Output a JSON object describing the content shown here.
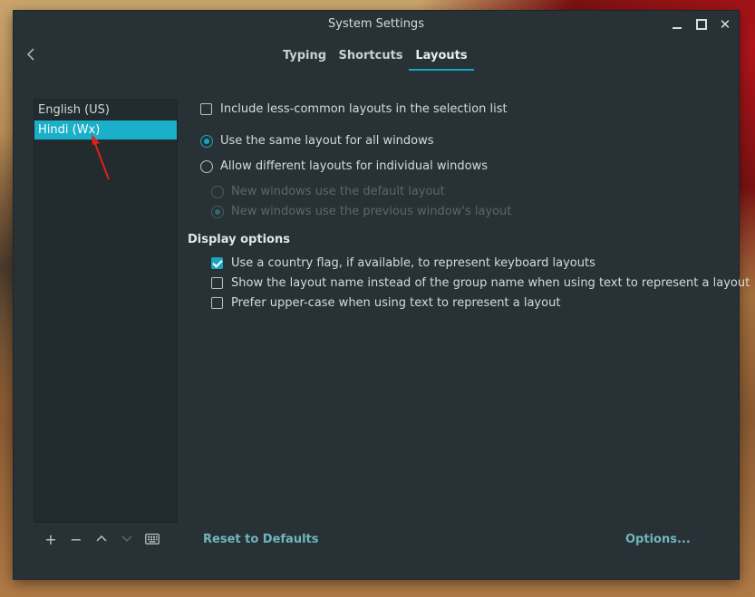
{
  "window": {
    "title": "System Settings"
  },
  "tabs": [
    {
      "label": "Typing",
      "active": false
    },
    {
      "label": "Shortcuts",
      "active": false
    },
    {
      "label": "Layouts",
      "active": true
    }
  ],
  "layouts": {
    "items": [
      {
        "label": "English (US)",
        "selected": false
      },
      {
        "label": "Hindi (Wx)",
        "selected": true
      }
    ]
  },
  "options": {
    "include_less_common": {
      "label": "Include less-common layouts in the selection list",
      "checked": false
    },
    "same_layout": {
      "label": "Use the same layout for all windows",
      "checked": true
    },
    "different_layouts": {
      "label": "Allow different layouts for individual windows",
      "checked": false
    },
    "new_default": {
      "label": "New windows use the default layout",
      "checked": false,
      "enabled": false
    },
    "new_previous": {
      "label": "New windows use the previous window's layout",
      "checked": true,
      "enabled": false
    }
  },
  "display": {
    "title": "Display options",
    "country_flag": {
      "label": "Use a country flag, if available,  to represent keyboard layouts",
      "checked": true
    },
    "layout_name": {
      "label": "Show the layout name instead of the group name when using text to represent a layout",
      "checked": false
    },
    "upper_case": {
      "label": "Prefer upper-case when using text to represent a layout",
      "checked": false
    }
  },
  "footer": {
    "reset_label": "Reset to Defaults",
    "options_label": "Options..."
  },
  "icons": {
    "back": "chevron-left-icon",
    "add": "plus-icon",
    "remove": "minus-icon",
    "up": "chevron-up-icon",
    "down": "chevron-down-icon",
    "keyboard": "keyboard-icon"
  },
  "colors": {
    "accent": "#1aa5bf",
    "selection": "#1ab0c9",
    "window_bg": "#283236",
    "annotation_arrow": "#e0201a"
  }
}
